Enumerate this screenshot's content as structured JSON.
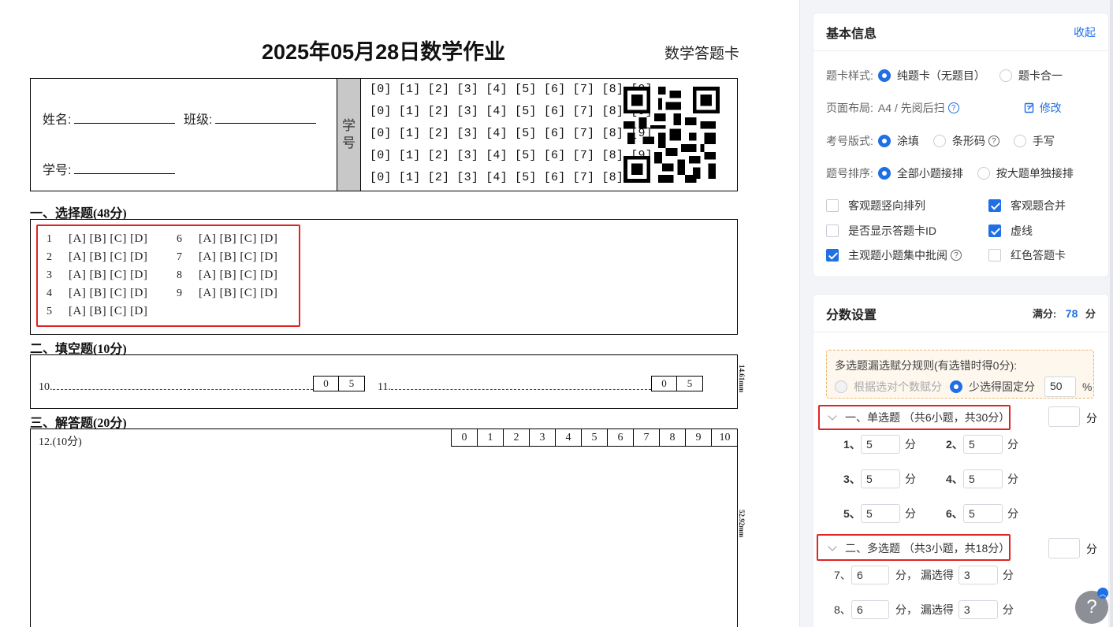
{
  "sheet": {
    "title": "2025年05月28日数学作业",
    "subtitle": "数学答题卡",
    "name_label": "姓名:",
    "class_label": "班级:",
    "student_id_label": "学号:",
    "xuehao_vertical_1": "学",
    "xuehao_vertical_2": "号",
    "digit_rows": [
      "[0] [1] [2] [3] [4] [5] [6] [7] [8] [9]",
      "[0] [1] [2] [3] [4] [5] [6] [7] [8] [9]",
      "[0] [1] [2] [3] [4] [5] [6] [7] [8] [9]",
      "[0] [1] [2] [3] [4] [5] [6] [7] [8] [9]",
      "[0] [1] [2] [3] [4] [5] [6] [7] [8] [9]"
    ],
    "section1": "一、选择题(48分)",
    "choices_left": [
      {
        "num": "1",
        "opts": "[A] [B] [C] [D]"
      },
      {
        "num": "2",
        "opts": "[A] [B] [C] [D]"
      },
      {
        "num": "3",
        "opts": "[A] [B] [C] [D]"
      },
      {
        "num": "4",
        "opts": "[A] [B] [C] [D]"
      },
      {
        "num": "5",
        "opts": "[A] [B] [C] [D]"
      }
    ],
    "choices_right": [
      {
        "num": "6",
        "opts": "[A] [B] [C] [D]"
      },
      {
        "num": "7",
        "opts": "[A] [B] [C] [D]"
      },
      {
        "num": "8",
        "opts": "[A] [B] [C] [D]"
      },
      {
        "num": "9",
        "opts": "[A] [B] [C] [D]"
      }
    ],
    "section2": "二、填空题(10分)",
    "fill_10": "10.",
    "fill_11": "11.",
    "fill_score": [
      "0",
      "5"
    ],
    "fill_mm": "14.61mm",
    "section3": "三、解答题(20分)",
    "q12": "12.(10分)",
    "q12_scores": [
      "0",
      "1",
      "2",
      "3",
      "4",
      "5",
      "6",
      "7",
      "8",
      "9",
      "10"
    ],
    "q12_mm": "52.92mm"
  },
  "basic": {
    "title": "基本信息",
    "collapse": "收起",
    "style_label": "题卡样式:",
    "style_opt1": "纯题卡（无题目）",
    "style_opt2": "题卡合一",
    "layout_label": "页面布局:",
    "layout_value": "A4 / 先阅后扫",
    "modify": "修改",
    "exam_label": "考号版式:",
    "exam_opt1": "涂填",
    "exam_opt2": "条形码",
    "exam_opt3": "手写",
    "order_label": "题号排序:",
    "order_opt1": "全部小题接排",
    "order_opt2": "按大题单独接排",
    "chk1": "客观题竖向排列",
    "chk2": "客观题合并",
    "chk3": "是否显示答题卡ID",
    "chk4": "虚线",
    "chk5": "主观题小题集中批阅",
    "chk6": "红色答题卡"
  },
  "score": {
    "title": "分数设置",
    "full_label": "满分:",
    "full_value": "78",
    "full_unit": "分",
    "rule_title": "多选题漏选赋分规则(有选错时得0分):",
    "rule_opt1": "根据选对个数赋分",
    "rule_opt2": "少选得固定分",
    "rule_percent": "50",
    "percent_sign": "%",
    "group1": "一、单选题 （共6小题，共30分）",
    "group2": "二、多选题 （共3小题，共18分）",
    "unit": "分",
    "single": [
      {
        "num": "1、",
        "val": "5"
      },
      {
        "num": "2、",
        "val": "5"
      },
      {
        "num": "3、",
        "val": "5"
      },
      {
        "num": "4、",
        "val": "5"
      },
      {
        "num": "5、",
        "val": "5"
      },
      {
        "num": "6、",
        "val": "5"
      }
    ],
    "multi": [
      {
        "num": "7、",
        "val": "6",
        "miss_label": "分，  漏选得",
        "miss": "3"
      },
      {
        "num": "8、",
        "val": "6",
        "miss_label": "分，  漏选得",
        "miss": "3"
      }
    ]
  },
  "help": "?",
  "colors": {
    "accent": "#1f6fe5",
    "highlight": "#e02424",
    "panel_bg": "#f3f4f7"
  }
}
